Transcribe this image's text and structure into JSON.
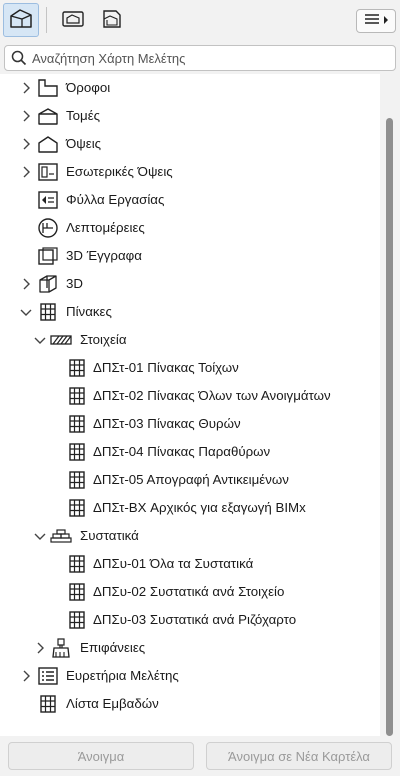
{
  "search": {
    "placeholder": "Αναζήτηση Χάρτη Μελέτης"
  },
  "tree": {
    "floors": "Όροφοι",
    "sections": "Τομές",
    "elevations": "Όψεις",
    "interior_elevations": "Εσωτερικές Όψεις",
    "worksheets": "Φύλλα Εργασίας",
    "details": "Λεπτομέρειες",
    "documents_3d": "3D Έγγραφα",
    "view_3d": "3D",
    "schedules": "Πίνακες",
    "elements": "Στοιχεία",
    "element_items": [
      "ΔΠΣτ-01 Πίνακας Τοίχων",
      "ΔΠΣτ-02 Πίνακας Όλων των Ανοιγμάτων",
      "ΔΠΣτ-03 Πίνακας Θυρών",
      "ΔΠΣτ-04 Πίνακας Παραθύρων",
      "ΔΠΣτ-05 Απογραφή Αντικειμένων",
      "ΔΠΣτ-BX Αρχικός για εξαγωγή BIMx"
    ],
    "components": "Συστατικά",
    "component_items": [
      "ΔΠΣυ-01 Όλα τα Συστατικά",
      "ΔΠΣυ-02 Συστατικά ανά Στοιχείο",
      "ΔΠΣυ-03 Συστατικά ανά Ριζόχαρτο"
    ],
    "surfaces": "Επιφάνειες",
    "project_indexes": "Ευρετήρια Μελέτης",
    "area_list": "Λίστα Εμβαδών"
  },
  "buttons": {
    "open": "Άνοιγμα",
    "open_new_tab": "Άνοιγμα σε Νέα Καρτέλα"
  },
  "colors": {
    "active_tab_bg": "#d6e6f5",
    "disabled_text": "#9a9a9a"
  }
}
